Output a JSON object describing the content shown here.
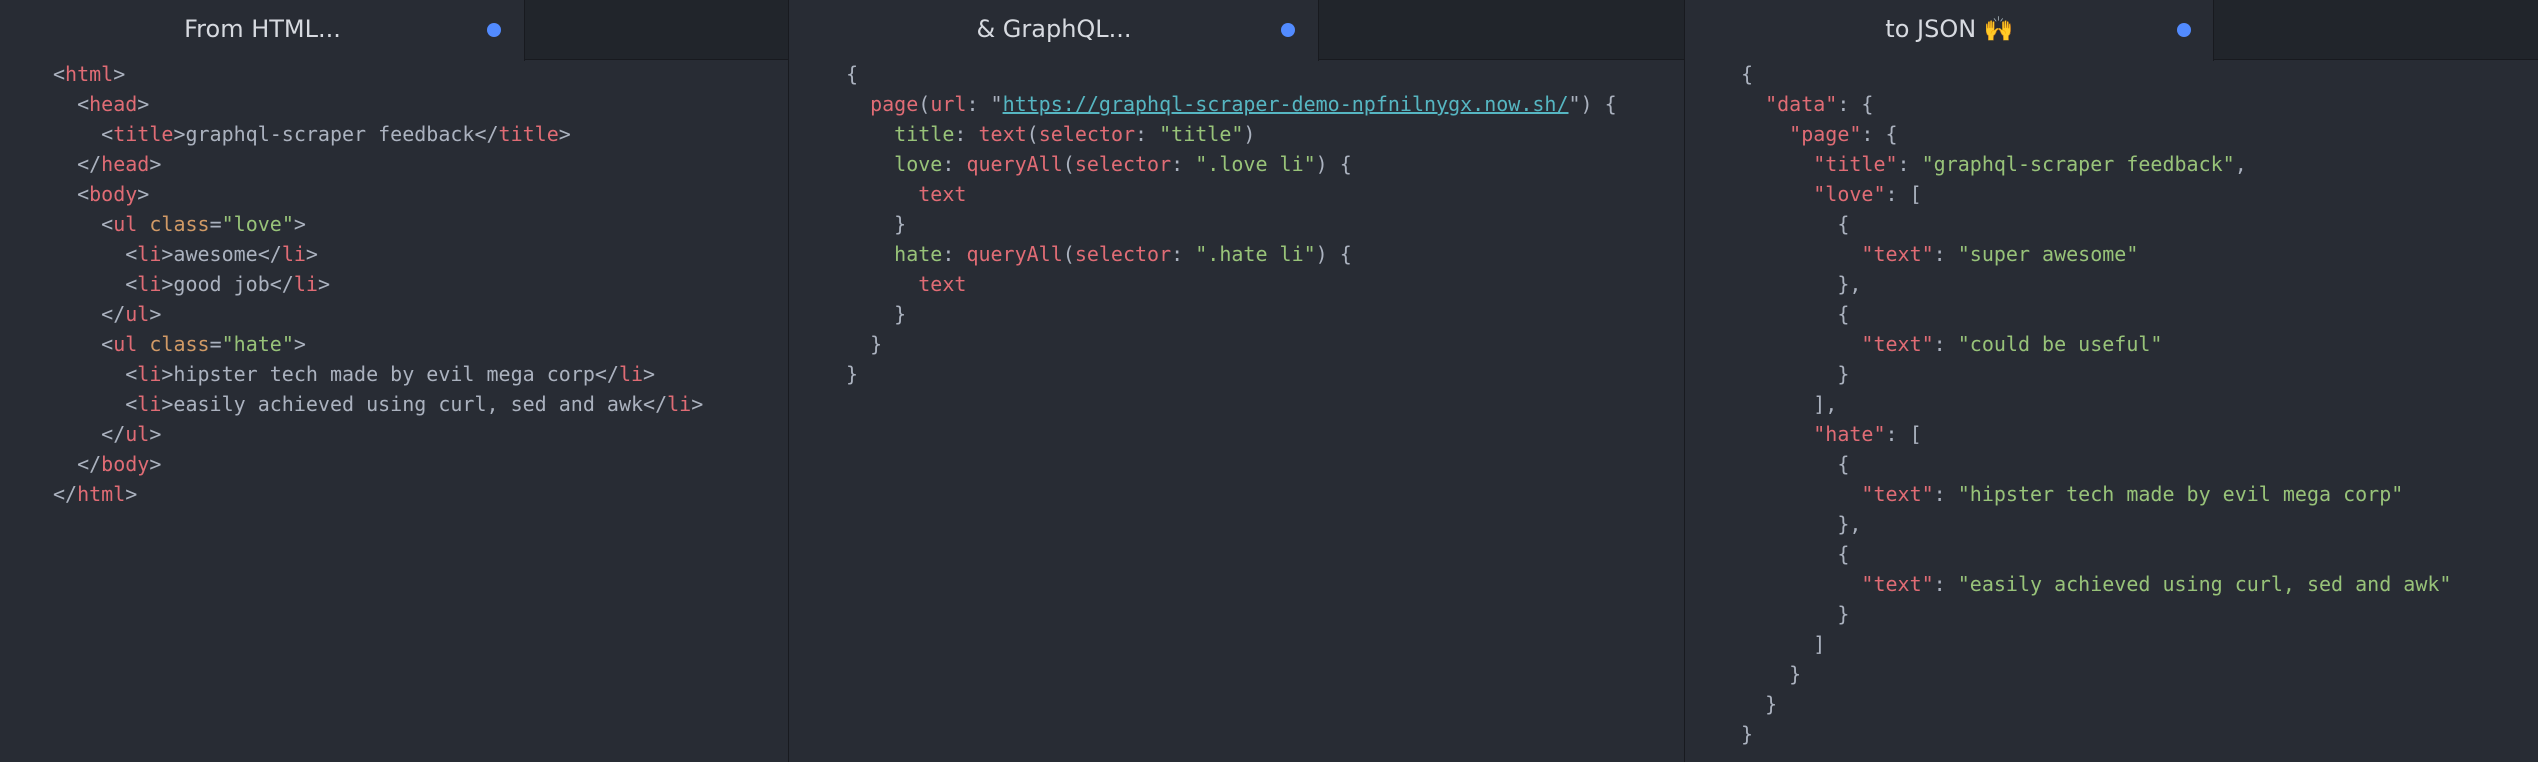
{
  "colors": {
    "background": "#282c34",
    "tabbar": "#21252b",
    "text": "#abb2bf",
    "red": "#e06c75",
    "orange": "#d19a66",
    "green": "#98c379",
    "cyan": "#56b6c2",
    "modified_dot": "#528bff"
  },
  "panes": [
    {
      "tab_title": "From HTML...",
      "modified_icon": "modified-dot-icon",
      "lines": [
        [
          {
            "t": "<",
            "c": "punct"
          },
          {
            "t": "html",
            "c": "tag"
          },
          {
            "t": ">",
            "c": "punct"
          }
        ],
        [
          {
            "t": "  <",
            "c": "punct"
          },
          {
            "t": "head",
            "c": "tag"
          },
          {
            "t": ">",
            "c": "punct"
          }
        ],
        [
          {
            "t": "    <",
            "c": "punct"
          },
          {
            "t": "title",
            "c": "tag"
          },
          {
            "t": ">graphql-scraper feedback</",
            "c": "punct"
          },
          {
            "t": "title",
            "c": "tag"
          },
          {
            "t": ">",
            "c": "punct"
          }
        ],
        [
          {
            "t": "  </",
            "c": "punct"
          },
          {
            "t": "head",
            "c": "tag"
          },
          {
            "t": ">",
            "c": "punct"
          }
        ],
        [
          {
            "t": "  <",
            "c": "punct"
          },
          {
            "t": "body",
            "c": "tag"
          },
          {
            "t": ">",
            "c": "punct"
          }
        ],
        [
          {
            "t": "    <",
            "c": "punct"
          },
          {
            "t": "ul",
            "c": "tag"
          },
          {
            "t": " ",
            "c": "punct"
          },
          {
            "t": "class",
            "c": "attr"
          },
          {
            "t": "=",
            "c": "punct"
          },
          {
            "t": "\"love\"",
            "c": "str"
          },
          {
            "t": ">",
            "c": "punct"
          }
        ],
        [
          {
            "t": "      <",
            "c": "punct"
          },
          {
            "t": "li",
            "c": "tag"
          },
          {
            "t": ">awesome</",
            "c": "punct"
          },
          {
            "t": "li",
            "c": "tag"
          },
          {
            "t": ">",
            "c": "punct"
          }
        ],
        [
          {
            "t": "      <",
            "c": "punct"
          },
          {
            "t": "li",
            "c": "tag"
          },
          {
            "t": ">good job</",
            "c": "punct"
          },
          {
            "t": "li",
            "c": "tag"
          },
          {
            "t": ">",
            "c": "punct"
          }
        ],
        [
          {
            "t": "    </",
            "c": "punct"
          },
          {
            "t": "ul",
            "c": "tag"
          },
          {
            "t": ">",
            "c": "punct"
          }
        ],
        [
          {
            "t": "    <",
            "c": "punct"
          },
          {
            "t": "ul",
            "c": "tag"
          },
          {
            "t": " ",
            "c": "punct"
          },
          {
            "t": "class",
            "c": "attr"
          },
          {
            "t": "=",
            "c": "punct"
          },
          {
            "t": "\"hate\"",
            "c": "str"
          },
          {
            "t": ">",
            "c": "punct"
          }
        ],
        [
          {
            "t": "      <",
            "c": "punct"
          },
          {
            "t": "li",
            "c": "tag"
          },
          {
            "t": ">hipster tech made by evil mega corp</",
            "c": "punct"
          },
          {
            "t": "li",
            "c": "tag"
          },
          {
            "t": ">",
            "c": "punct"
          }
        ],
        [
          {
            "t": "      <",
            "c": "punct"
          },
          {
            "t": "li",
            "c": "tag"
          },
          {
            "t": ">easily achieved using curl, sed and awk</",
            "c": "punct"
          },
          {
            "t": "li",
            "c": "tag"
          },
          {
            "t": ">",
            "c": "punct"
          }
        ],
        [
          {
            "t": "    </",
            "c": "punct"
          },
          {
            "t": "ul",
            "c": "tag"
          },
          {
            "t": ">",
            "c": "punct"
          }
        ],
        [
          {
            "t": "  </",
            "c": "punct"
          },
          {
            "t": "body",
            "c": "tag"
          },
          {
            "t": ">",
            "c": "punct"
          }
        ],
        [
          {
            "t": "</",
            "c": "punct"
          },
          {
            "t": "html",
            "c": "tag"
          },
          {
            "t": ">",
            "c": "punct"
          }
        ]
      ]
    },
    {
      "tab_title": "& GraphQL...",
      "modified_icon": "modified-dot-icon",
      "lines": [
        [
          {
            "t": "{",
            "c": "punct"
          }
        ],
        [
          {
            "t": "  ",
            "c": "punct"
          },
          {
            "t": "page",
            "c": "fn"
          },
          {
            "t": "(",
            "c": "punct"
          },
          {
            "t": "url",
            "c": "fn"
          },
          {
            "t": ": \"",
            "c": "punct"
          },
          {
            "t": "https://graphql-scraper-demo-npfnilnygx.now.sh/",
            "c": "url"
          },
          {
            "t": "\") {",
            "c": "punct"
          }
        ],
        [
          {
            "t": "    ",
            "c": "punct"
          },
          {
            "t": "title",
            "c": "prop"
          },
          {
            "t": ": ",
            "c": "punct"
          },
          {
            "t": "text",
            "c": "fn"
          },
          {
            "t": "(",
            "c": "punct"
          },
          {
            "t": "selector",
            "c": "fn"
          },
          {
            "t": ": ",
            "c": "punct"
          },
          {
            "t": "\"title\"",
            "c": "str"
          },
          {
            "t": ")",
            "c": "punct"
          }
        ],
        [
          {
            "t": "    ",
            "c": "punct"
          },
          {
            "t": "love",
            "c": "prop"
          },
          {
            "t": ": ",
            "c": "punct"
          },
          {
            "t": "queryAll",
            "c": "fn"
          },
          {
            "t": "(",
            "c": "punct"
          },
          {
            "t": "selector",
            "c": "fn"
          },
          {
            "t": ": ",
            "c": "punct"
          },
          {
            "t": "\".love li\"",
            "c": "str"
          },
          {
            "t": ") {",
            "c": "punct"
          }
        ],
        [
          {
            "t": "      ",
            "c": "punct"
          },
          {
            "t": "text",
            "c": "fn"
          }
        ],
        [
          {
            "t": "    }",
            "c": "punct"
          }
        ],
        [
          {
            "t": "    ",
            "c": "punct"
          },
          {
            "t": "hate",
            "c": "prop"
          },
          {
            "t": ": ",
            "c": "punct"
          },
          {
            "t": "queryAll",
            "c": "fn"
          },
          {
            "t": "(",
            "c": "punct"
          },
          {
            "t": "selector",
            "c": "fn"
          },
          {
            "t": ": ",
            "c": "punct"
          },
          {
            "t": "\".hate li\"",
            "c": "str"
          },
          {
            "t": ") {",
            "c": "punct"
          }
        ],
        [
          {
            "t": "      ",
            "c": "punct"
          },
          {
            "t": "text",
            "c": "fn"
          }
        ],
        [
          {
            "t": "    }",
            "c": "punct"
          }
        ],
        [
          {
            "t": "  }",
            "c": "punct"
          }
        ],
        [
          {
            "t": "}",
            "c": "punct"
          }
        ]
      ]
    },
    {
      "tab_title": "to JSON 🙌",
      "modified_icon": "modified-dot-icon",
      "lines": [
        [
          {
            "t": "{",
            "c": "punct"
          }
        ],
        [
          {
            "t": "  ",
            "c": "punct"
          },
          {
            "t": "\"data\"",
            "c": "key"
          },
          {
            "t": ": {",
            "c": "punct"
          }
        ],
        [
          {
            "t": "    ",
            "c": "punct"
          },
          {
            "t": "\"page\"",
            "c": "key"
          },
          {
            "t": ": {",
            "c": "punct"
          }
        ],
        [
          {
            "t": "      ",
            "c": "punct"
          },
          {
            "t": "\"title\"",
            "c": "key"
          },
          {
            "t": ": ",
            "c": "punct"
          },
          {
            "t": "\"graphql-scraper feedback\"",
            "c": "str"
          },
          {
            "t": ",",
            "c": "punct"
          }
        ],
        [
          {
            "t": "      ",
            "c": "punct"
          },
          {
            "t": "\"love\"",
            "c": "key"
          },
          {
            "t": ": [",
            "c": "punct"
          }
        ],
        [
          {
            "t": "        {",
            "c": "punct"
          }
        ],
        [
          {
            "t": "          ",
            "c": "punct"
          },
          {
            "t": "\"text\"",
            "c": "key"
          },
          {
            "t": ": ",
            "c": "punct"
          },
          {
            "t": "\"super awesome\"",
            "c": "str"
          }
        ],
        [
          {
            "t": "        },",
            "c": "punct"
          }
        ],
        [
          {
            "t": "        {",
            "c": "punct"
          }
        ],
        [
          {
            "t": "          ",
            "c": "punct"
          },
          {
            "t": "\"text\"",
            "c": "key"
          },
          {
            "t": ": ",
            "c": "punct"
          },
          {
            "t": "\"could be useful\"",
            "c": "str"
          }
        ],
        [
          {
            "t": "        }",
            "c": "punct"
          }
        ],
        [
          {
            "t": "      ],",
            "c": "punct"
          }
        ],
        [
          {
            "t": "      ",
            "c": "punct"
          },
          {
            "t": "\"hate\"",
            "c": "key"
          },
          {
            "t": ": [",
            "c": "punct"
          }
        ],
        [
          {
            "t": "        {",
            "c": "punct"
          }
        ],
        [
          {
            "t": "          ",
            "c": "punct"
          },
          {
            "t": "\"text\"",
            "c": "key"
          },
          {
            "t": ": ",
            "c": "punct"
          },
          {
            "t": "\"hipster tech made by evil mega corp\"",
            "c": "str"
          }
        ],
        [
          {
            "t": "        },",
            "c": "punct"
          }
        ],
        [
          {
            "t": "        {",
            "c": "punct"
          }
        ],
        [
          {
            "t": "          ",
            "c": "punct"
          },
          {
            "t": "\"text\"",
            "c": "key"
          },
          {
            "t": ": ",
            "c": "punct"
          },
          {
            "t": "\"easily achieved using curl, sed and awk\"",
            "c": "str"
          }
        ],
        [
          {
            "t": "        }",
            "c": "punct"
          }
        ],
        [
          {
            "t": "      ]",
            "c": "punct"
          }
        ],
        [
          {
            "t": "    }",
            "c": "punct"
          }
        ],
        [
          {
            "t": "  }",
            "c": "punct"
          }
        ],
        [
          {
            "t": "}",
            "c": "punct"
          }
        ]
      ]
    }
  ]
}
